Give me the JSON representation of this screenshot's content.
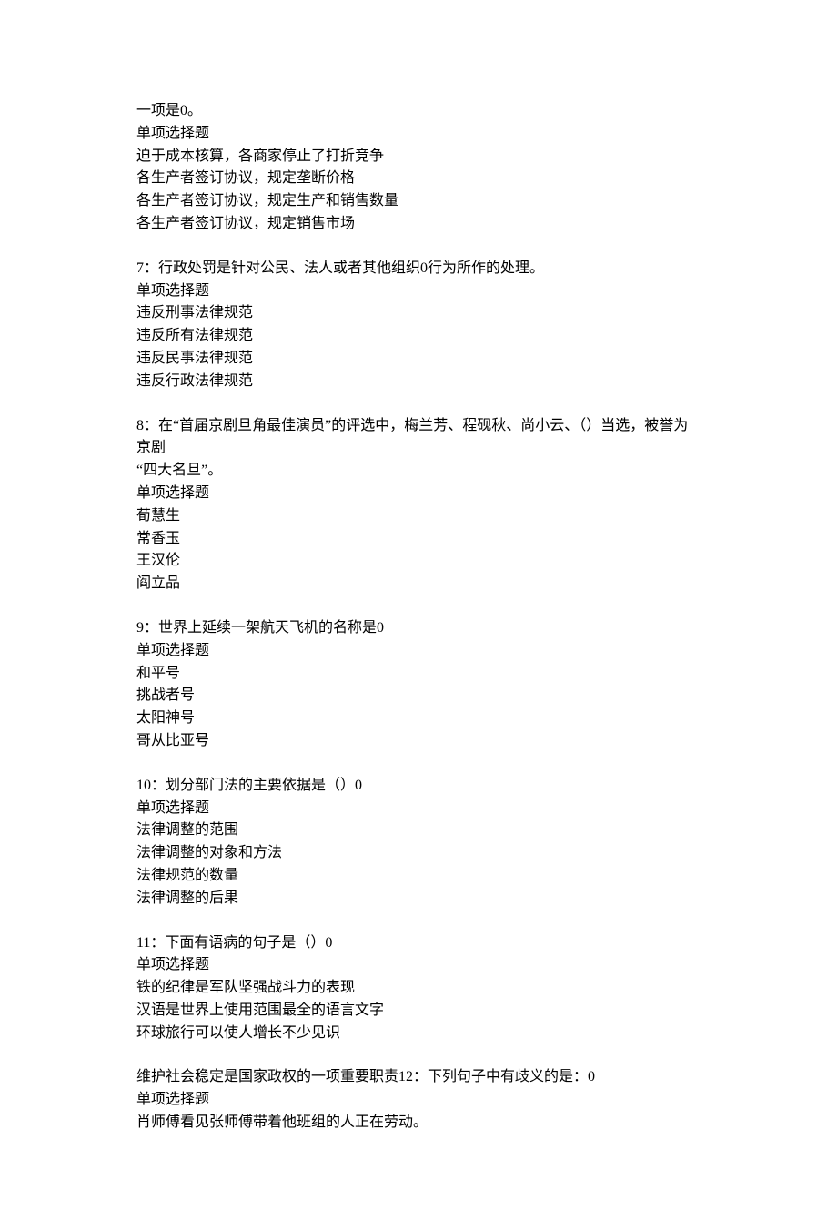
{
  "frag": {
    "l1": "一项是0。",
    "l2": "单项选择题",
    "l3": "迫于成本核算，各商家停止了打折竞争",
    "l4": "各生产者签订协议，规定垄断价格",
    "l5": "各生产者签订协议，规定生产和销售数量",
    "l6": "各生产者签订协议，规定销售市场"
  },
  "q7": {
    "stem": "7：行政处罚是针对公民、法人或者其他组织0行为所作的处理。",
    "type": "单项选择题",
    "a": "违反刑事法律规范",
    "b": "违反所有法律规范",
    "c": "违反民事法律规范",
    "d": "违反行政法律规范"
  },
  "q8": {
    "stem1": "8：在“首届京剧旦角最佳演员”的评选中，梅兰芳、程砚秋、尚小云、（）当选，被誉为京剧",
    "stem2": "“四大名旦”。",
    "type": "单项选择题",
    "a": "荀慧生",
    "b": "常香玉",
    "c": "王汉伦",
    "d": "阎立品"
  },
  "q9": {
    "stem": "9：世界上延续一架航天飞机的名称是0",
    "type": "单项选择题",
    "a": "和平号",
    "b": "挑战者号",
    "c": "太阳神号",
    "d": "哥从比亚号"
  },
  "q10": {
    "stem": "10：划分部门法的主要依据是（）0",
    "type": "单项选择题",
    "a": "法律调整的范围",
    "b": "法律调整的对象和方法",
    "c": "法律规范的数量",
    "d": "法律调整的后果"
  },
  "q11": {
    "stem": "11：下面有语病的句子是（）0",
    "type": "单项选择题",
    "a": "铁的纪律是军队坚强战斗力的表现",
    "b": "汉语是世界上使用范围最全的语言文字",
    "c": "环球旅行可以使人增长不少见识"
  },
  "q12": {
    "stem": "维护社会稳定是国家政权的一项重要职责12：下列句子中有歧义的是：0",
    "type": "单项选择题",
    "a": "肖师傅看见张师傅带着他班组的人正在劳动。"
  }
}
